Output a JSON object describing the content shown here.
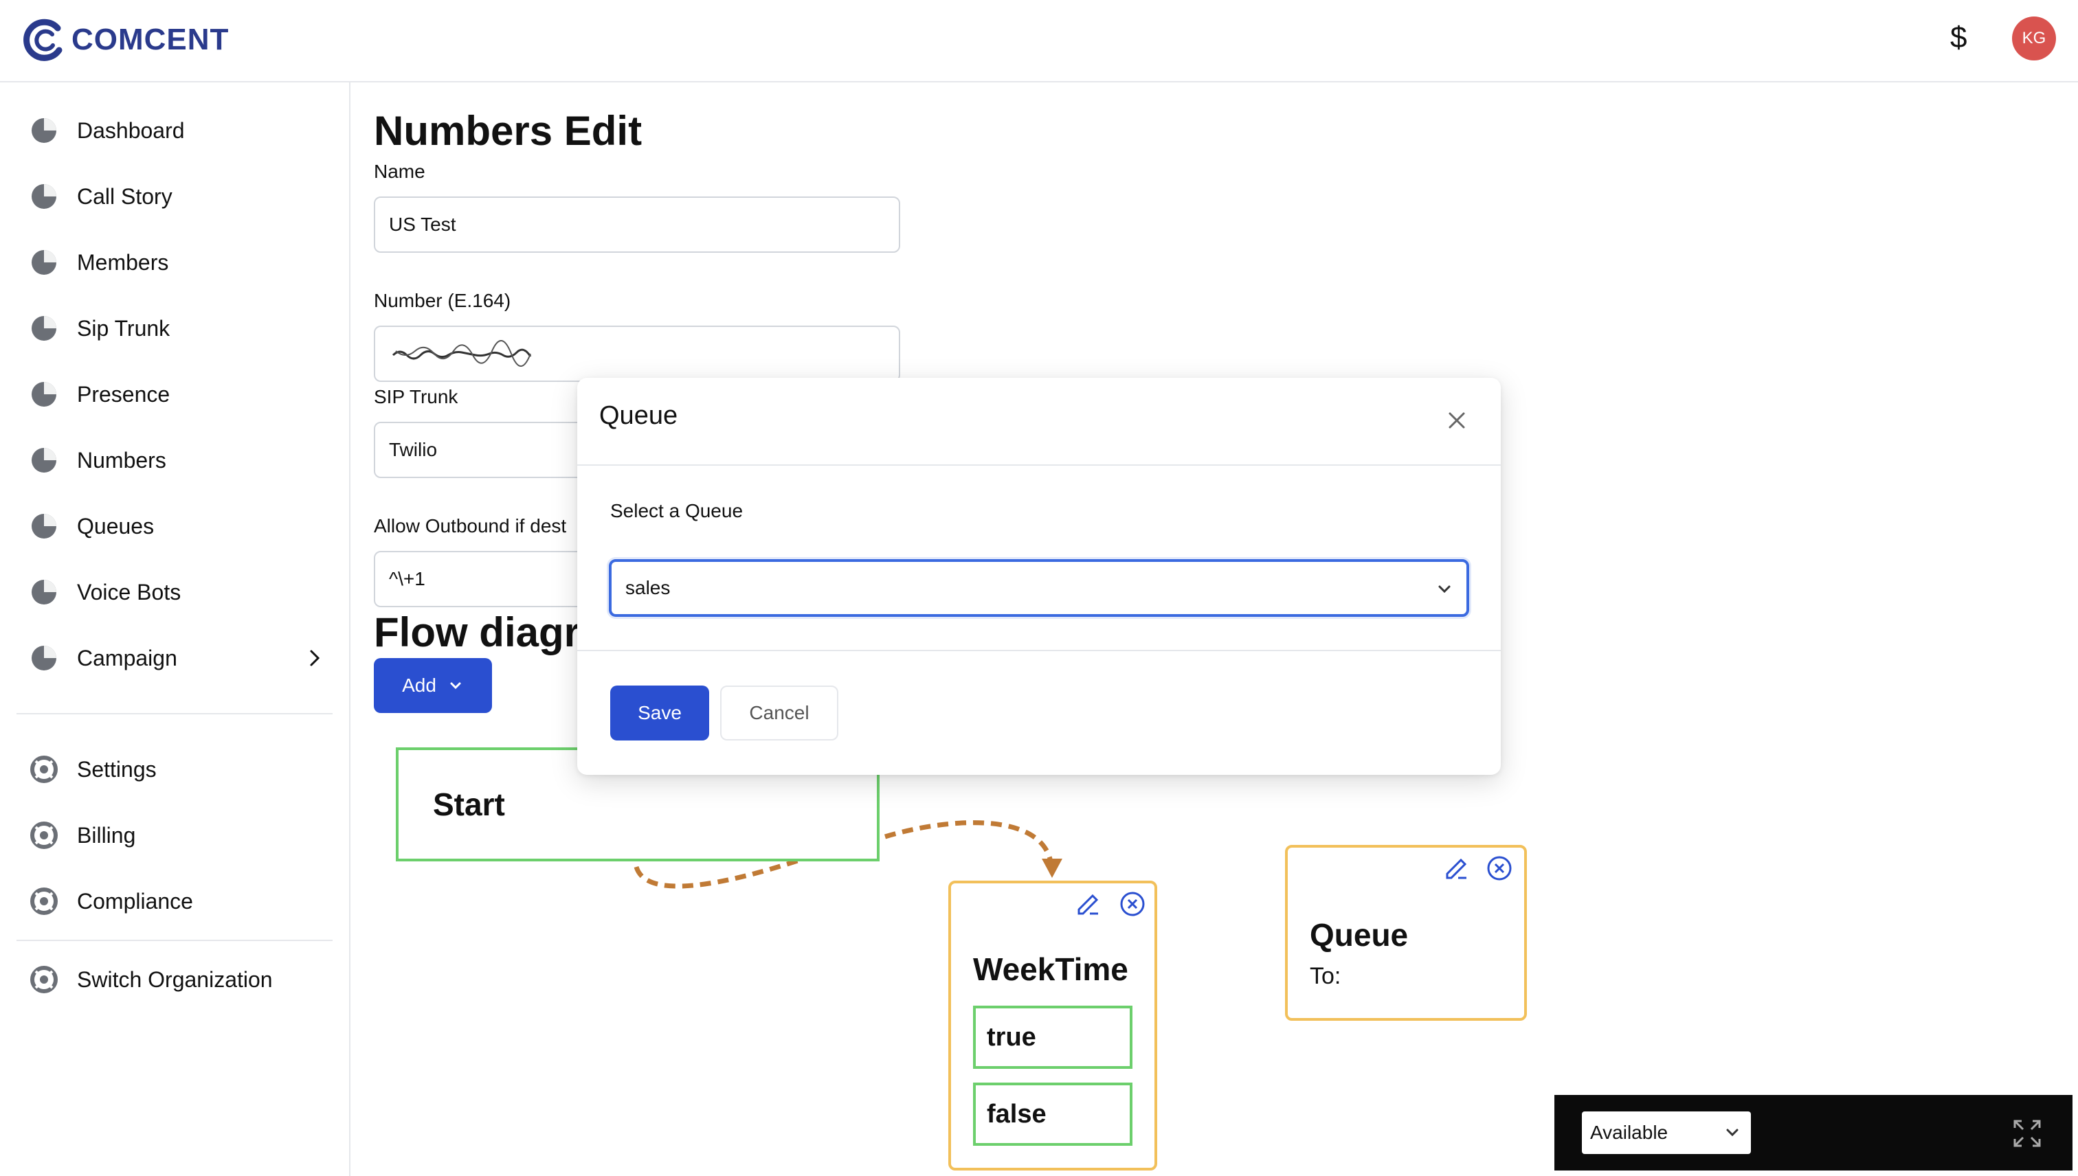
{
  "app": {
    "brand": "COMCENT",
    "currency_symbol": "$",
    "user_initials": "KG"
  },
  "sidebar": {
    "items": [
      {
        "label": "Dashboard"
      },
      {
        "label": "Call Story"
      },
      {
        "label": "Members"
      },
      {
        "label": "Sip Trunk"
      },
      {
        "label": "Presence"
      },
      {
        "label": "Numbers"
      },
      {
        "label": "Queues"
      },
      {
        "label": "Voice Bots"
      },
      {
        "label": "Campaign"
      }
    ],
    "secondary": [
      {
        "label": "Settings"
      },
      {
        "label": "Billing"
      },
      {
        "label": "Compliance"
      }
    ],
    "tertiary": [
      {
        "label": "Switch Organization"
      }
    ]
  },
  "form": {
    "title": "Numbers Edit",
    "name_label": "Name",
    "name_value": "US Test",
    "number_label": "Number (E.164)",
    "sip_label": "SIP Trunk",
    "sip_value": "Twilio",
    "outbound_label": "Allow Outbound if dest",
    "outbound_value": "^\\+1"
  },
  "flow": {
    "title": "Flow diagra",
    "add_label": "Add",
    "start_label": "Start",
    "weektime": {
      "title": "WeekTime",
      "true_label": "true",
      "false_label": "false"
    },
    "queue": {
      "title": "Queue",
      "to_label": "To:"
    }
  },
  "modal": {
    "title": "Queue",
    "select_label": "Select a Queue",
    "selected": "sales",
    "save_label": "Save",
    "cancel_label": "Cancel"
  },
  "status": {
    "value": "Available"
  },
  "colors": {
    "primary": "#2a4fd0",
    "brand": "#2a3a8c",
    "node_green": "#6ccf6c",
    "node_yellow": "#f2c05a",
    "edge": "#c07a35"
  }
}
